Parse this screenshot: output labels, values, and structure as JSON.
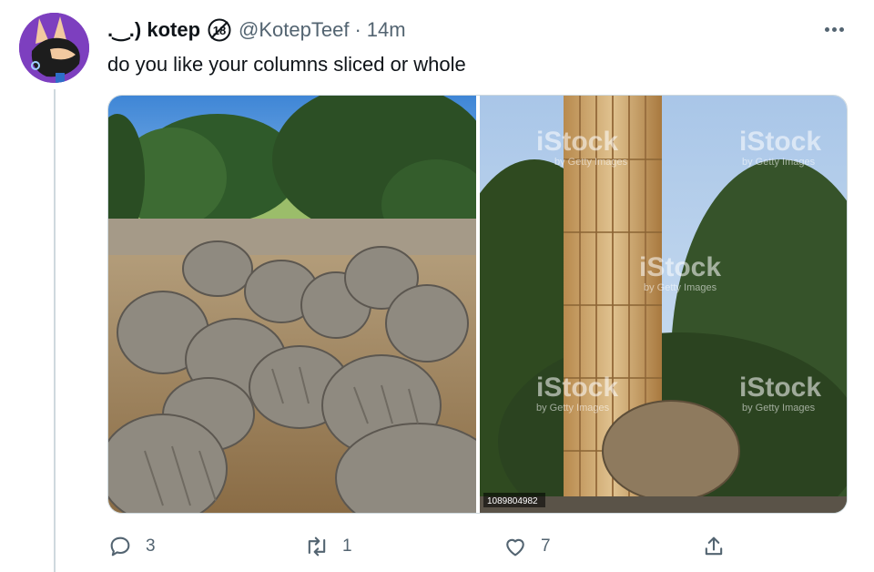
{
  "tweet": {
    "display_name": ".‿.) kotep",
    "handle": "@KotepTeef",
    "separator": "·",
    "time": "14m",
    "text": "do you like your columns sliced or whole",
    "badge_icon": "eighteen-plus-icon"
  },
  "media": {
    "left_image": "fallen-column-drums-photo",
    "right_image": "standing-column-photo",
    "watermark": "iStock",
    "watermark_sub": "by Getty Images",
    "image_id": "1089804982"
  },
  "actions": {
    "reply_count": "3",
    "retweet_count": "1",
    "like_count": "7"
  },
  "colors": {
    "text_primary": "#0f1419",
    "text_secondary": "#536471",
    "thread_line": "#cfd9de",
    "avatar_bg": "#7d3fbf"
  }
}
